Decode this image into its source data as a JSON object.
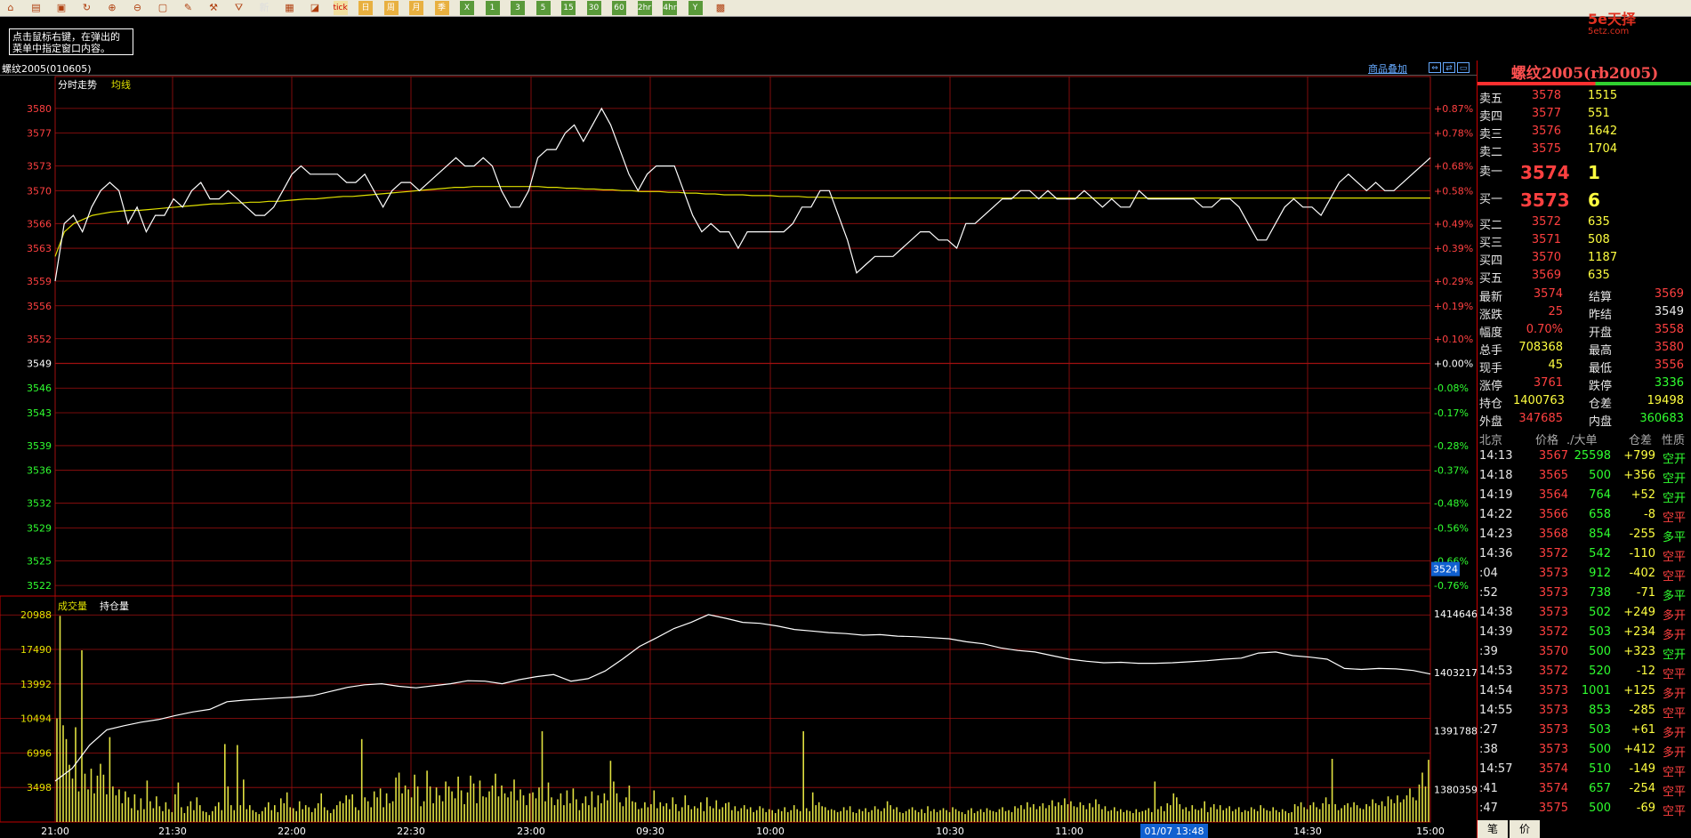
{
  "toolbar": {
    "icons": [
      "home-icon",
      "folder-icon",
      "save-icon",
      "refresh-icon",
      "zoom-in-icon",
      "zoom-out-icon",
      "window-icon",
      "pen-icon",
      "tool-icon",
      "filter-icon",
      "new-icon",
      "table-icon",
      "chart-icon",
      "tick-icon",
      "day-icon",
      "week-icon",
      "month-icon",
      "season-icon",
      "year-icon",
      "1min-icon",
      "3min-icon",
      "5min-icon",
      "15min-icon",
      "30min-icon",
      "60min-icon",
      "2hr-icon",
      "4hr-icon",
      "yearly-icon",
      "calc-icon"
    ],
    "labels": [
      "",
      "",
      "",
      "",
      "",
      "",
      "",
      "",
      "",
      "",
      "新",
      "",
      "",
      "tick",
      "日",
      "周",
      "月",
      "季",
      "X",
      "1",
      "3",
      "5",
      "15",
      "30",
      "60",
      "2hr",
      "4hr",
      "Y",
      ""
    ]
  },
  "tooltip": {
    "line1": "点击鼠标右键，在弹出的",
    "line2": "菜单中指定窗口内容。"
  },
  "logo": {
    "name": "5e天择",
    "url": "5etz.com"
  },
  "instrument": {
    "label": "螺纹2005(010605)"
  },
  "overlay_link": "商品叠加",
  "price_panel": {
    "label": "分时走势",
    "avg_label": "均线",
    "cursor_value": "3524"
  },
  "volume_panel": {
    "volume_label": "成交量",
    "oi_label": "持仓量"
  },
  "time_axis": {
    "labels": [
      "21:00",
      "21:30",
      "22:00",
      "22:30",
      "23:00",
      "09:30",
      "10:00",
      "10:30",
      "11:00",
      "11:30",
      "14:30",
      "15:00"
    ],
    "cursor_time": "01/07 13:48"
  },
  "chart_data": {
    "type": "line",
    "price_axis": {
      "ticks": [
        3580,
        3577,
        3573,
        3570,
        3566,
        3563,
        3559,
        3556,
        3552,
        3549,
        3546,
        3543,
        3539,
        3536,
        3532,
        3529,
        3525,
        3522
      ],
      "pct_ticks": [
        "+0.87%",
        "+0.78%",
        "+0.68%",
        "+0.58%",
        "+0.49%",
        "+0.39%",
        "+0.29%",
        "+0.19%",
        "+0.10%",
        "+0.00%",
        "-0.08%",
        "-0.17%",
        "-0.28%",
        "-0.37%",
        "-0.48%",
        "-0.56%",
        "-0.66%",
        "-0.76%"
      ],
      "ylim": [
        3520.5,
        3581.5
      ],
      "base": 3549
    },
    "series": [
      {
        "name": "分时走势",
        "values": [
          3559,
          3566,
          3567,
          3565,
          3568,
          3570,
          3571,
          3570,
          3566,
          3568,
          3565,
          3567,
          3567,
          3569,
          3568,
          3570,
          3571,
          3569,
          3569,
          3570,
          3569,
          3568,
          3567,
          3567,
          3568,
          3570,
          3572,
          3573,
          3572,
          3572,
          3572,
          3572,
          3571,
          3571,
          3572,
          3570,
          3568,
          3570,
          3571,
          3571,
          3570,
          3571,
          3572,
          3573,
          3574,
          3573,
          3573,
          3574,
          3573,
          3570,
          3568,
          3568,
          3570,
          3574,
          3575,
          3575,
          3577,
          3578,
          3576,
          3578,
          3580,
          3578,
          3575,
          3572,
          3570,
          3572,
          3573,
          3573,
          3573,
          3570,
          3567,
          3565,
          3566,
          3565,
          3565,
          3563,
          3565,
          3565,
          3565,
          3565,
          3565,
          3566,
          3568,
          3568,
          3570,
          3570,
          3567,
          3564,
          3560,
          3561,
          3562,
          3562,
          3562,
          3563,
          3564,
          3565,
          3565,
          3564,
          3564,
          3563,
          3566,
          3566,
          3567,
          3568,
          3569,
          3569,
          3570,
          3570,
          3569,
          3570,
          3569,
          3569,
          3569,
          3570,
          3569,
          3568,
          3569,
          3568,
          3568,
          3570,
          3569,
          3569,
          3569,
          3569,
          3569,
          3569,
          3568,
          3568,
          3569,
          3569,
          3568,
          3566,
          3564,
          3564,
          3566,
          3568,
          3569,
          3568,
          3568,
          3567,
          3569,
          3571,
          3572,
          3571,
          3570,
          3571,
          3570,
          3570,
          3571,
          3572,
          3573,
          3574
        ]
      },
      {
        "name": "均线",
        "values": [
          3562,
          3565,
          3566,
          3566.5,
          3567,
          3567.2,
          3567.4,
          3567.5,
          3567.6,
          3567.6,
          3567.7,
          3567.8,
          3567.9,
          3568,
          3568.1,
          3568.2,
          3568.3,
          3568.4,
          3568.4,
          3568.5,
          3568.5,
          3568.6,
          3568.6,
          3568.7,
          3568.7,
          3568.8,
          3568.9,
          3569,
          3569,
          3569.1,
          3569.2,
          3569.3,
          3569.3,
          3569.4,
          3569.5,
          3569.6,
          3569.7,
          3569.8,
          3569.9,
          3570,
          3570.1,
          3570.2,
          3570.3,
          3570.4,
          3570.4,
          3570.5,
          3570.5,
          3570.5,
          3570.5,
          3570.5,
          3570.5,
          3570.5,
          3570.5,
          3570.4,
          3570.4,
          3570.3,
          3570.3,
          3570.2,
          3570.2,
          3570.1,
          3570.1,
          3570,
          3570,
          3569.9,
          3569.9,
          3569.9,
          3569.8,
          3569.8,
          3569.7,
          3569.7,
          3569.6,
          3569.6,
          3569.5,
          3569.5,
          3569.5,
          3569.4,
          3569.4,
          3569.4,
          3569.3,
          3569.3,
          3569.3,
          3569.2,
          3569.2,
          3569.2,
          3569.1,
          3569.1,
          3569.1,
          3569.1,
          3569.1,
          3569.1,
          3569.1,
          3569.1,
          3569.1,
          3569.1,
          3569.1,
          3569.1,
          3569.1,
          3569.1,
          3569.1,
          3569.1,
          3569.1,
          3569.1,
          3569.1,
          3569.1,
          3569.1,
          3569.1,
          3569.1,
          3569.1,
          3569.1,
          3569.1,
          3569.1,
          3569.1,
          3569.1,
          3569.1,
          3569.1,
          3569.1,
          3569.1,
          3569.1,
          3569.1,
          3569.1,
          3569.1,
          3569.1,
          3569.1,
          3569.1,
          3569.1,
          3569.1,
          3569.1,
          3569.1,
          3569.1,
          3569.1,
          3569.1,
          3569.1,
          3569.1,
          3569.1,
          3569.1,
          3569.1,
          3569.1,
          3569.1,
          3569.1,
          3569.1,
          3569.1,
          3569.1,
          3569.1,
          3569.1,
          3569.1,
          3569.1,
          3569.1,
          3569.1,
          3569.1
        ]
      },
      {
        "name": "持仓量",
        "values": [
          1382000,
          1384500,
          1389000,
          1392000,
          1392800,
          1393500,
          1394000,
          1394800,
          1395500,
          1396000,
          1397500,
          1397800,
          1398000,
          1398200,
          1398400,
          1398700,
          1399500,
          1400300,
          1400800,
          1401000,
          1400500,
          1400200,
          1400600,
          1401000,
          1401600,
          1401500,
          1401000,
          1401800,
          1402400,
          1402800,
          1401500,
          1402000,
          1403500,
          1405800,
          1408300,
          1410000,
          1411800,
          1413000,
          1414500,
          1413800,
          1413000,
          1412800,
          1412300,
          1411600,
          1411300,
          1411000,
          1410800,
          1410500,
          1410600,
          1410300,
          1410200,
          1410000,
          1409800,
          1409200,
          1408800,
          1408000,
          1407500,
          1407200,
          1406500,
          1405800,
          1405400,
          1405100,
          1405200,
          1405000,
          1405000,
          1405100,
          1405300,
          1405500,
          1405800,
          1406000,
          1407000,
          1407200,
          1406500,
          1406200,
          1405800,
          1404000,
          1403800,
          1404000,
          1403900,
          1403600,
          1402900
        ]
      }
    ],
    "volume_axis": {
      "ticks": [
        20988,
        17490,
        13992,
        10494,
        6996,
        3498
      ],
      "ylim": [
        0,
        22000
      ]
    },
    "oi_axis": {
      "ticks": [
        1414646,
        1403217,
        1391788,
        1380359
      ],
      "ylim": [
        1374000,
        1416400
      ]
    },
    "volume": [
      10500,
      20900,
      9800,
      8400,
      5800,
      4400,
      9600,
      3100,
      17400,
      4900,
      3300,
      5400,
      2900,
      4700,
      5900,
      4800,
      2800,
      8600,
      3600,
      2700,
      3300,
      1900,
      3100,
      2500,
      1400,
      2800,
      1200,
      2400,
      1300,
      4200,
      2100,
      1400,
      2600,
      1600,
      1100,
      2000,
      1300,
      1000,
      2800,
      4000,
      1500,
      900,
      1600,
      2100,
      1200,
      2500,
      1700,
      1100,
      1000,
      700,
      1100,
      1600,
      2000,
      1200,
      7900,
      3600,
      1700,
      1200,
      7800,
      1700,
      4300,
      1300,
      1700,
      1200,
      1000,
      800,
      1100,
      1500,
      2000,
      1200,
      1700,
      1000,
      2400,
      1900,
      3000,
      1500,
      1400,
      1100,
      2100,
      1300,
      1700,
      1500,
      1000,
      1400,
      1900,
      2900,
      1500,
      1200,
      900,
      1300,
      1700,
      2100,
      1900,
      2700,
      2300,
      2800,
      1500,
      1200,
      8400,
      2500,
      2100,
      1500,
      3100,
      2500,
      3400,
      1500,
      2900,
      1900,
      2100,
      4500,
      5000,
      2900,
      3700,
      3300,
      2500,
      4800,
      3600,
      1600,
      2100,
      5200,
      3600,
      1900,
      3500,
      2700,
      2100,
      4100,
      3600,
      3100,
      2400,
      4600,
      3200,
      1800,
      3000,
      4700,
      3900,
      1900,
      4200,
      2600,
      2500,
      3100,
      3700,
      4900,
      2600,
      3700,
      2900,
      2500,
      3100,
      4300,
      2200,
      3300,
      2700,
      1700,
      2900,
      3000,
      2400,
      3500,
      9200,
      2100,
      4000,
      2500,
      1700,
      2300,
      2900,
      1700,
      3200,
      1900,
      3400,
      2300,
      1200,
      1900,
      2600,
      1700,
      3100,
      1500,
      2700,
      1900,
      2900,
      2200,
      6200,
      4100,
      2900,
      2000,
      1600,
      2500,
      3700,
      2100,
      2000,
      1300,
      1400,
      2000,
      1500,
      1800,
      3200,
      1400,
      2000,
      1600,
      1900,
      1300,
      2500,
      1800,
      1100,
      1500,
      2700,
      1700,
      1300,
      1600,
      1400,
      2000,
      1100,
      2500,
      1600,
      1400,
      2200,
      1300,
      1500,
      1900,
      2000,
      1200,
      1600,
      1100,
      1400,
      1700,
      1300,
      1500,
      1000,
      1200,
      1600,
      1400,
      1000,
      1300,
      1200,
      900,
      1300,
      1100,
      1500,
      1000,
      1200,
      1700,
      1300,
      1100,
      9200,
      1400,
      1100,
      3000,
      1700,
      2000,
      1600,
      1500,
      1200,
      1300,
      1200,
      1000,
      1100,
      1500,
      1200,
      1600,
      1000,
      900,
      1300,
      1100,
      1400,
      1000,
      1200,
      1600,
      1300,
      1100,
      1400,
      2100,
      1700,
      1300,
      1500,
      1000,
      900,
      1100,
      1300,
      1500,
      1200,
      1000,
      1300,
      900,
      1600,
      1100,
      1300,
      1000,
      1200,
      1400,
      1200,
      1000,
      1500,
      1300,
      1100,
      1000,
      800,
      1200,
      1400,
      900,
      1100,
      1300,
      1000,
      1400,
      1200,
      1100,
      1000,
      1300,
      1500,
      1100,
      1200,
      1000,
      1600,
      1400,
      1700,
      1300,
      2000,
      1500,
      1800,
      1300,
      1600,
      1900,
      1400,
      1700,
      2200,
      1600,
      2000,
      1700,
      2400,
      1800,
      2100,
      1600,
      1500,
      2000,
      1700,
      1300,
      1900,
      1500,
      2300,
      1800,
      1300,
      1600,
      1100,
      1200,
      1500,
      1100,
      1300,
      1000,
      1200,
      1100,
      900,
      1300,
      1000,
      1100,
      1200,
      1400,
      1000,
      4100,
      1300,
      1600,
      1100,
      1900,
      1700,
      2900,
      2500,
      1800,
      1300,
      1500,
      1100,
      1700,
      1300,
      1200,
      1400,
      2100,
      1000,
      1500,
      1800,
      1300,
      1700,
      1200,
      1400,
      1600,
      1100,
      1300,
      1500,
      1000,
      1200,
      1100,
      1500,
      1300,
      1100,
      1700,
      1400,
      1200,
      1100,
      1500,
      1200,
      1000,
      1300,
      1100,
      900,
      1000,
      1800,
      1600,
      2000,
      1500,
      1300,
      1700,
      2000,
      1500,
      1300,
      1900,
      2500,
      1800,
      6400,
      1800,
      1200,
      1400,
      1700,
      1900,
      1500,
      2000,
      1700,
      1400,
      1300,
      1800,
      1600,
      2300,
      1900,
      1700,
      2100,
      1600,
      2600,
      2300,
      1900,
      2700,
      2000,
      2300,
      2700,
      3400,
      2500,
      2200,
      3800,
      5000,
      3600,
      6300
    ]
  },
  "quote": {
    "title": "螺纹2005(rb2005)",
    "sell": [
      {
        "label": "卖五",
        "price": "3578",
        "vol": "1515"
      },
      {
        "label": "卖四",
        "price": "3577",
        "vol": "551"
      },
      {
        "label": "卖三",
        "price": "3576",
        "vol": "1642"
      },
      {
        "label": "卖二",
        "price": "3575",
        "vol": "1704"
      }
    ],
    "sell1": {
      "label": "卖一",
      "price": "3574",
      "vol": "1"
    },
    "buy1": {
      "label": "买一",
      "price": "3573",
      "vol": "6"
    },
    "buy": [
      {
        "label": "买二",
        "price": "3572",
        "vol": "635"
      },
      {
        "label": "买三",
        "price": "3571",
        "vol": "508"
      },
      {
        "label": "买四",
        "price": "3570",
        "vol": "1187"
      },
      {
        "label": "买五",
        "price": "3569",
        "vol": "635"
      }
    ],
    "stats": [
      {
        "l1": "最新",
        "v1": "3574",
        "c1": "red",
        "l2": "结算",
        "v2": "3569",
        "c2": "red"
      },
      {
        "l1": "涨跌",
        "v1": "25",
        "c1": "red",
        "l2": "昨结",
        "v2": "3549",
        "c2": "wht"
      },
      {
        "l1": "幅度",
        "v1": "0.70%",
        "c1": "red",
        "l2": "开盘",
        "v2": "3558",
        "c2": "red"
      },
      {
        "l1": "总手",
        "v1": "708368",
        "c1": "yel",
        "l2": "最高",
        "v2": "3580",
        "c2": "red"
      },
      {
        "l1": "现手",
        "v1": "45",
        "c1": "yel",
        "l2": "最低",
        "v2": "3556",
        "c2": "red"
      },
      {
        "l1": "涨停",
        "v1": "3761",
        "c1": "red",
        "l2": "跌停",
        "v2": "3336",
        "c2": "grn"
      },
      {
        "l1": "持仓",
        "v1": "1400763",
        "c1": "yel",
        "l2": "仓差",
        "v2": "19498",
        "c2": "yel"
      },
      {
        "l1": "外盘",
        "v1": "347685",
        "c1": "red",
        "l2": "内盘",
        "v2": "360683",
        "c2": "grn"
      }
    ],
    "trade_headers": [
      "北京",
      "价格",
      "./大单",
      "仓差",
      "性质"
    ],
    "trades": [
      {
        "t": "14:13",
        "p": "3567",
        "v": "25598",
        "d": "+799",
        "n": "空开",
        "nc": "grn"
      },
      {
        "t": "14:18",
        "p": "3565",
        "v": "500",
        "d": "+356",
        "n": "空开",
        "nc": "grn"
      },
      {
        "t": "14:19",
        "p": "3564",
        "v": "764",
        "d": "+52",
        "n": "空开",
        "nc": "grn"
      },
      {
        "t": "14:22",
        "p": "3566",
        "v": "658",
        "d": "-8",
        "n": "空平",
        "nc": "red"
      },
      {
        "t": "14:23",
        "p": "3568",
        "v": "854",
        "d": "-255",
        "n": "多平",
        "nc": "grn"
      },
      {
        "t": "14:36",
        "p": "3572",
        "v": "542",
        "d": "-110",
        "n": "空平",
        "nc": "red"
      },
      {
        "t": ":04",
        "p": "3573",
        "v": "912",
        "d": "-402",
        "n": "空平",
        "nc": "red"
      },
      {
        "t": ":52",
        "p": "3573",
        "v": "738",
        "d": "-71",
        "n": "多平",
        "nc": "grn"
      },
      {
        "t": "14:38",
        "p": "3573",
        "v": "502",
        "d": "+249",
        "n": "多开",
        "nc": "red"
      },
      {
        "t": "14:39",
        "p": "3572",
        "v": "503",
        "d": "+234",
        "n": "多开",
        "nc": "red"
      },
      {
        "t": ":39",
        "p": "3570",
        "v": "500",
        "d": "+323",
        "n": "空开",
        "nc": "grn"
      },
      {
        "t": "14:53",
        "p": "3572",
        "v": "520",
        "d": "-12",
        "n": "空平",
        "nc": "red"
      },
      {
        "t": "14:54",
        "p": "3573",
        "v": "1001",
        "d": "+125",
        "n": "多开",
        "nc": "red"
      },
      {
        "t": "14:55",
        "p": "3573",
        "v": "853",
        "d": "-285",
        "n": "空平",
        "nc": "red"
      },
      {
        "t": ":27",
        "p": "3573",
        "v": "503",
        "d": "+61",
        "n": "多开",
        "nc": "red"
      },
      {
        "t": ":38",
        "p": "3573",
        "v": "500",
        "d": "+412",
        "n": "多开",
        "nc": "red"
      },
      {
        "t": "14:57",
        "p": "3574",
        "v": "510",
        "d": "-149",
        "n": "空平",
        "nc": "red"
      },
      {
        "t": ":41",
        "p": "3574",
        "v": "657",
        "d": "-254",
        "n": "空平",
        "nc": "red"
      },
      {
        "t": ":47",
        "p": "3575",
        "v": "500",
        "d": "-69",
        "n": "空平",
        "nc": "red"
      }
    ],
    "bottom_tabs": [
      "笔",
      "价"
    ]
  },
  "colors": {
    "up": "#ff4040",
    "down": "#30ff30",
    "grid": "#a01010",
    "price_line": "#ffffff",
    "avg_line": "#e0e000",
    "volume": "#e0e040"
  }
}
